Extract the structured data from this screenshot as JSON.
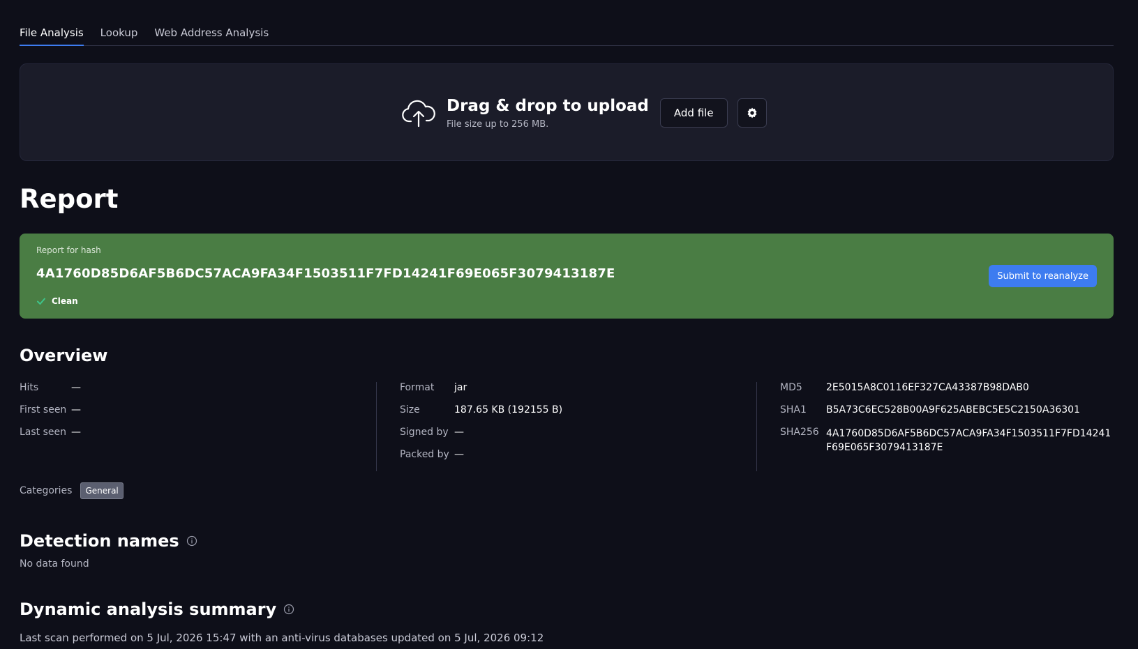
{
  "tabs": [
    {
      "label": "File Analysis",
      "active": true
    },
    {
      "label": "Lookup",
      "active": false
    },
    {
      "label": "Web Address Analysis",
      "active": false
    }
  ],
  "upload": {
    "title": "Drag & drop to upload",
    "subtitle": "File size up to 256 MB.",
    "add_file_label": "Add file",
    "icon": "cloud-upload-icon",
    "settings_icon": "gear-icon"
  },
  "report": {
    "heading": "Report",
    "hash_label": "Report for hash",
    "hash": "4A1760D85D6AF5B6DC57ACA9FA34F1503511F7FD14241F69E065F3079413187E",
    "status": "Clean",
    "reanalyze_label": "Submit to reanalyze",
    "status_color": "#4a7d44"
  },
  "overview": {
    "title": "Overview",
    "col1": [
      {
        "label": "Hits",
        "value": "—"
      },
      {
        "label": "First seen",
        "value": "—"
      },
      {
        "label": "Last seen",
        "value": "—"
      }
    ],
    "col2": [
      {
        "label": "Format",
        "value": "jar"
      },
      {
        "label": "Size",
        "value": "187.65 KB (192155 B)"
      },
      {
        "label": "Signed by",
        "value": "—"
      },
      {
        "label": "Packed by",
        "value": "—"
      }
    ],
    "col3": [
      {
        "label": "MD5",
        "value": "2E5015A8C0116EF327CA43387B98DAB0"
      },
      {
        "label": "SHA1",
        "value": "B5A73C6EC528B00A9F625ABEBC5E5C2150A36301"
      },
      {
        "label": "SHA256",
        "value": "4A1760D85D6AF5B6DC57ACA9FA34F1503511F7FD14241F69E065F3079413187E"
      }
    ],
    "categories_label": "Categories",
    "category": "General"
  },
  "detection": {
    "title": "Detection names",
    "empty": "No data found"
  },
  "dynamic": {
    "title": "Dynamic analysis summary",
    "last_scan": "Last scan performed on 5 Jul, 2026 15:47 with an anti-virus databases updated on 5 Jul, 2026 09:12"
  },
  "colors": {
    "background": "#0e0f19",
    "accent": "#3d7cf0",
    "clean": "#4a7d44"
  }
}
